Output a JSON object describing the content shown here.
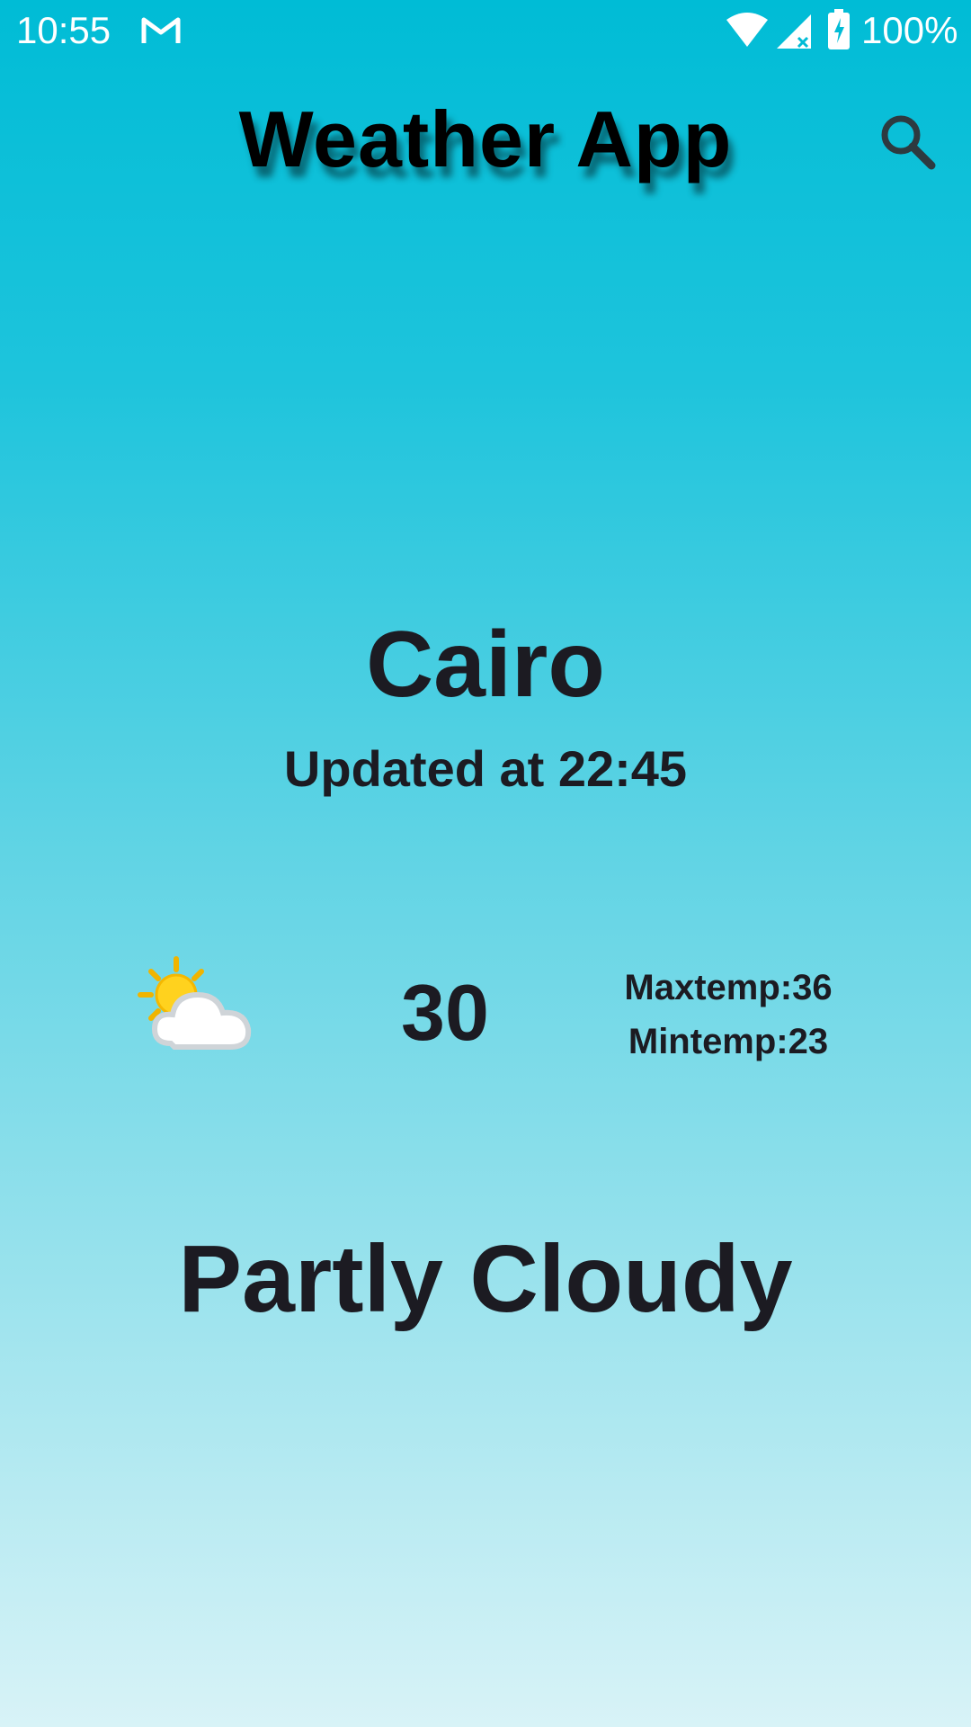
{
  "status_bar": {
    "time": "10:55",
    "battery": "100%",
    "icons": [
      "gmail-icon",
      "wifi-icon",
      "signal-icon",
      "battery-icon"
    ]
  },
  "app_bar": {
    "title": "Weather App",
    "search_icon": "search-icon"
  },
  "weather": {
    "city": "Cairo",
    "updated": "Updated at 22:45",
    "icon": "partly-cloudy-icon",
    "temp": "30",
    "max_temp": "Maxtemp:36",
    "min_temp": "Mintemp:23",
    "condition": "Partly Cloudy"
  },
  "colors": {
    "gradient_top": "#00bcd6",
    "gradient_bottom": "#d8f3f7",
    "text": "#1c1b22"
  }
}
